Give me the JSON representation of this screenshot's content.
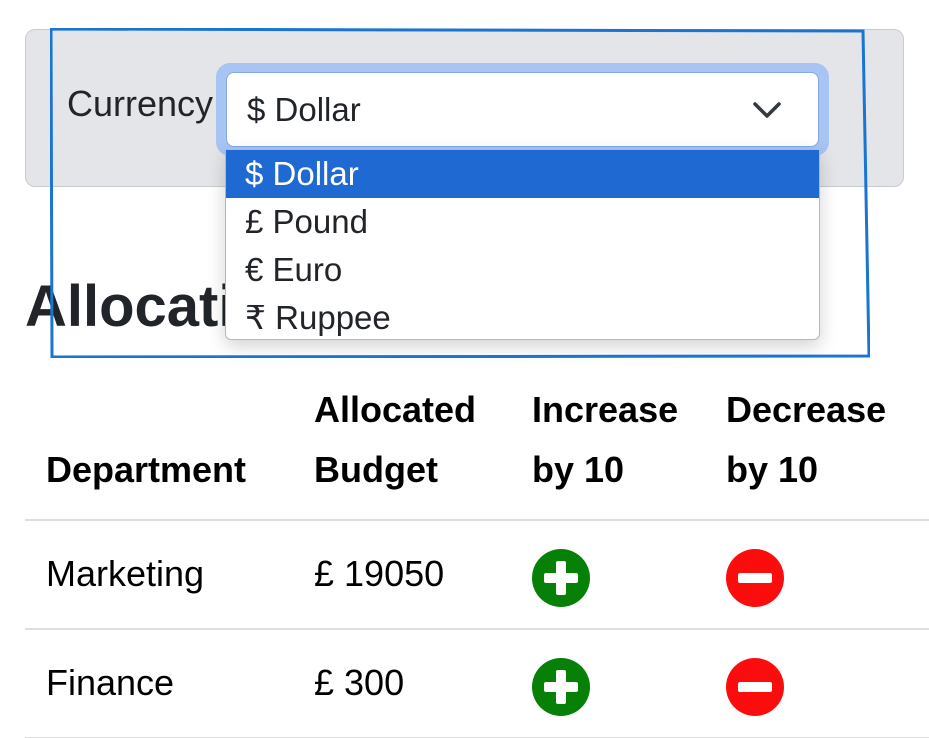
{
  "currency": {
    "label": "Currency",
    "selected_value": "$ Dollar",
    "options": [
      {
        "label": "$ Dollar",
        "selected": true
      },
      {
        "label": "£ Pound",
        "selected": false
      },
      {
        "label": "€ Euro",
        "selected": false
      },
      {
        "label": "₹ Ruppee",
        "selected": false
      }
    ]
  },
  "section": {
    "title": "Allocation"
  },
  "table": {
    "headers": {
      "department": "Department",
      "allocated_budget": "Allocated Budget",
      "increase": "Increase by 10",
      "decrease": "Decrease by 10"
    },
    "rows": [
      {
        "department": "Marketing",
        "budget": "£ 19050"
      },
      {
        "department": "Finance",
        "budget": "£ 300"
      }
    ]
  },
  "colors": {
    "panel_bg": "#e4e5e8",
    "option_highlight": "#1f69d3",
    "increase_button": "#078007",
    "decrease_button": "#fb0d0d",
    "annotation_outline": "#1a74d2"
  },
  "icons": {
    "select_chevron": "chevron-down-icon",
    "increase": "plus-circle-icon",
    "decrease": "minus-circle-icon"
  }
}
